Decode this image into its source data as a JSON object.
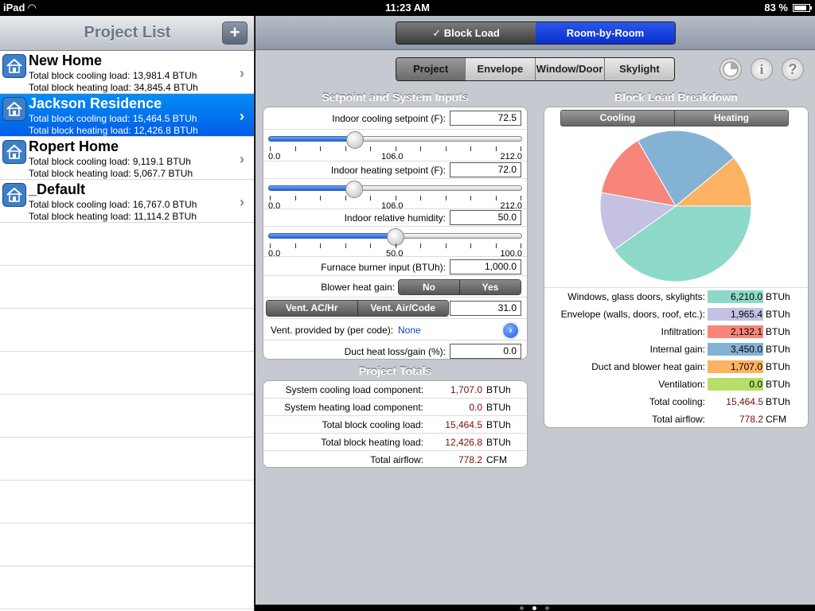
{
  "status": {
    "device": "iPad",
    "time": "11:23 AM",
    "battery": "83 %"
  },
  "sidebar": {
    "title": "Project List",
    "add_label": "+",
    "projects": [
      {
        "name": "New Home",
        "cooling": "Total block cooling load: 13,981.4 BTUh",
        "heating": "Total block heating load: 34,845.4 BTUh"
      },
      {
        "name": "Jackson Residence",
        "cooling": "Total block cooling load: 15,464.5 BTUh",
        "heating": "Total block heating load: 12,426.8 BTUh"
      },
      {
        "name": "Ropert Home",
        "cooling": "Total block cooling load: 9,119.1 BTUh",
        "heating": "Total block heating load: 5,067.7 BTUh"
      },
      {
        "name": "_Default",
        "cooling": "Total block cooling load: 16,767.0 BTUh",
        "heating": "Total block heating load: 11,114.2 BTUh"
      }
    ],
    "selected_index": 1
  },
  "mode": {
    "block_load": "✓ Block Load",
    "room_by_room": "Room-by-Room"
  },
  "tabs": [
    "Project",
    "Envelope",
    "Window/Door",
    "Skylight"
  ],
  "toolbar_icons": [
    "pie-chart-icon",
    "info-icon",
    "help-icon"
  ],
  "setpoint": {
    "title": "Setpoint and System Inputs",
    "cooling_label": "Indoor cooling setpoint (F):",
    "cooling_value": "72.5",
    "cooling_slider": {
      "min": "0.0",
      "mid": "106.0",
      "max": "212.0",
      "value": 72.5,
      "range": [
        0,
        212
      ]
    },
    "heating_label": "Indoor heating setpoint (F):",
    "heating_value": "72.0",
    "heating_slider": {
      "min": "0.0",
      "mid": "106.0",
      "max": "212.0",
      "value": 72.0,
      "range": [
        0,
        212
      ]
    },
    "humidity_label": "Indoor relative humidity:",
    "humidity_value": "50.0",
    "humidity_slider": {
      "min": "0.0",
      "mid": "50.0",
      "max": "100.0",
      "value": 50.0,
      "range": [
        0,
        100
      ]
    },
    "furnace_label": "Furnace burner input (BTUh):",
    "furnace_value": "1,000.0",
    "blower_label": "Blower heat gain:",
    "blower_no": "No",
    "blower_yes": "Yes",
    "vent_ac": "Vent. AC/Hr",
    "vent_air": "Vent. Air/Code",
    "vent_value": "31.0",
    "vent_provided_label": "Vent. provided by (per code):",
    "vent_provided_value": "None",
    "duct_label": "Duct heat loss/gain (%):",
    "duct_value": "0.0"
  },
  "totals": {
    "title": "Project Totals",
    "rows": [
      {
        "label": "System cooling load component:",
        "value": "1,707.0",
        "unit": "BTUh"
      },
      {
        "label": "System heating load component:",
        "value": "0.0",
        "unit": "BTUh"
      },
      {
        "label": "Total block cooling load:",
        "value": "15,464.5",
        "unit": "BTUh"
      },
      {
        "label": "Total block heating load:",
        "value": "12,426.8",
        "unit": "BTUh"
      },
      {
        "label": "Total airflow:",
        "value": "778.2",
        "unit": "CFM"
      }
    ]
  },
  "breakdown": {
    "title": "Block Load Breakdown",
    "seg_cooling": "Cooling",
    "seg_heating": "Heating",
    "rows": [
      {
        "label": "Windows, glass doors, skylights:",
        "value": "6,210.0",
        "unit": "BTUh",
        "color": "#8dd9c9"
      },
      {
        "label": "Envelope (walls, doors, roof, etc.):",
        "value": "1,965.4",
        "unit": "BTUh",
        "color": "#c4c1e2"
      },
      {
        "label": "Infiltration:",
        "value": "2,132.1",
        "unit": "BTUh",
        "color": "#f7857a"
      },
      {
        "label": "Internal gain:",
        "value": "3,450.0",
        "unit": "BTUh",
        "color": "#83b2d4"
      },
      {
        "label": "Duct and blower heat gain:",
        "value": "1,707.0",
        "unit": "BTUh",
        "color": "#fbb262"
      },
      {
        "label": "Ventilation:",
        "value": "0.0",
        "unit": "BTUh",
        "color": "#b6de68"
      }
    ],
    "total_cooling_label": "Total cooling:",
    "total_cooling_value": "15,464.5",
    "total_cooling_unit": "BTUh",
    "total_airflow_label": "Total airflow:",
    "total_airflow_value": "778.2",
    "total_airflow_unit": "CFM"
  },
  "chart_data": {
    "type": "pie",
    "categories": [
      "Windows, glass doors, skylights",
      "Envelope (walls, doors, roof, etc.)",
      "Infiltration",
      "Internal gain",
      "Duct and blower heat gain",
      "Ventilation"
    ],
    "values": [
      6210.0,
      1965.4,
      2132.1,
      3450.0,
      1707.0,
      0.0
    ],
    "colors": [
      "#8dd9c9",
      "#c4c1e2",
      "#f7857a",
      "#83b2d4",
      "#fbb262",
      "#b6de68"
    ]
  },
  "page_dots": 3,
  "page_dot_active": 1
}
